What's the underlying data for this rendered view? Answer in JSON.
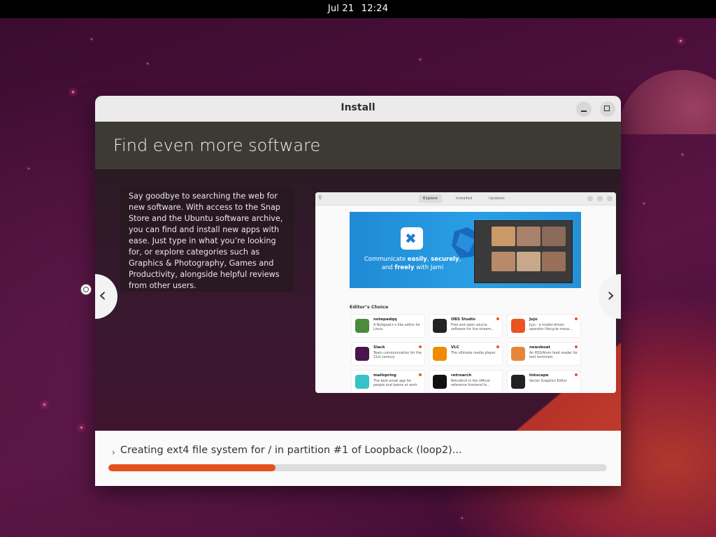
{
  "topbar": {
    "date": "Jul 21",
    "time": "12:24"
  },
  "window": {
    "title": "Install",
    "slide_title": "Find even more software",
    "description": "Say goodbye to searching the web for new software. With access to the Snap Store and the Ubuntu software archive, you can find and install new apps with ease. Just type in what you’re looking for, or explore categories such as Graphics & Photography, Games and Productivity, alongside helpful reviews from other users.",
    "nav_prev": "‹",
    "nav_next": "›"
  },
  "software_shot": {
    "tabs": [
      "Explore",
      "Installed",
      "Updates"
    ],
    "banner": {
      "line1": "Communicate ",
      "easily": "easily",
      "sep1": ", ",
      "securely": "securely",
      "line2": ", and ",
      "freely": "freely",
      "line3": " with Jami"
    },
    "editors_choice": "Editor’s Choice",
    "apps": [
      {
        "name": "notepadqq",
        "desc": "A Notepad++-like editor for Linux.",
        "color": "#4b8b3b"
      },
      {
        "name": "OBS Studio",
        "desc": "Free and open source software for live stream...",
        "color": "#222222"
      },
      {
        "name": "Jujo",
        "desc": "Juju - a model-driven operator lifecycle mana...",
        "color": "#e95420"
      },
      {
        "name": "Slack",
        "desc": "Team communication for the 21st century.",
        "color": "#4a154b"
      },
      {
        "name": "VLC",
        "desc": "The ultimate media player",
        "color": "#f08a00"
      },
      {
        "name": "newsboat",
        "desc": "An RSS/Atom feed reader for text terminals",
        "color": "#e6863a"
      },
      {
        "name": "mailspring",
        "desc": "The best email app for people and teams at work",
        "color": "#37c1c8"
      },
      {
        "name": "retroarch",
        "desc": "RetroArch is the official reference frontend fo...",
        "color": "#111111"
      },
      {
        "name": "Inkscape",
        "desc": "Vector Graphics Editor",
        "color": "#222222"
      }
    ]
  },
  "progress": {
    "status_text": "Creating ext4 file system for / in partition #1 of Loopback (loop2)...",
    "expander": "›",
    "fraction": 0.335,
    "color": "#e4521c"
  }
}
